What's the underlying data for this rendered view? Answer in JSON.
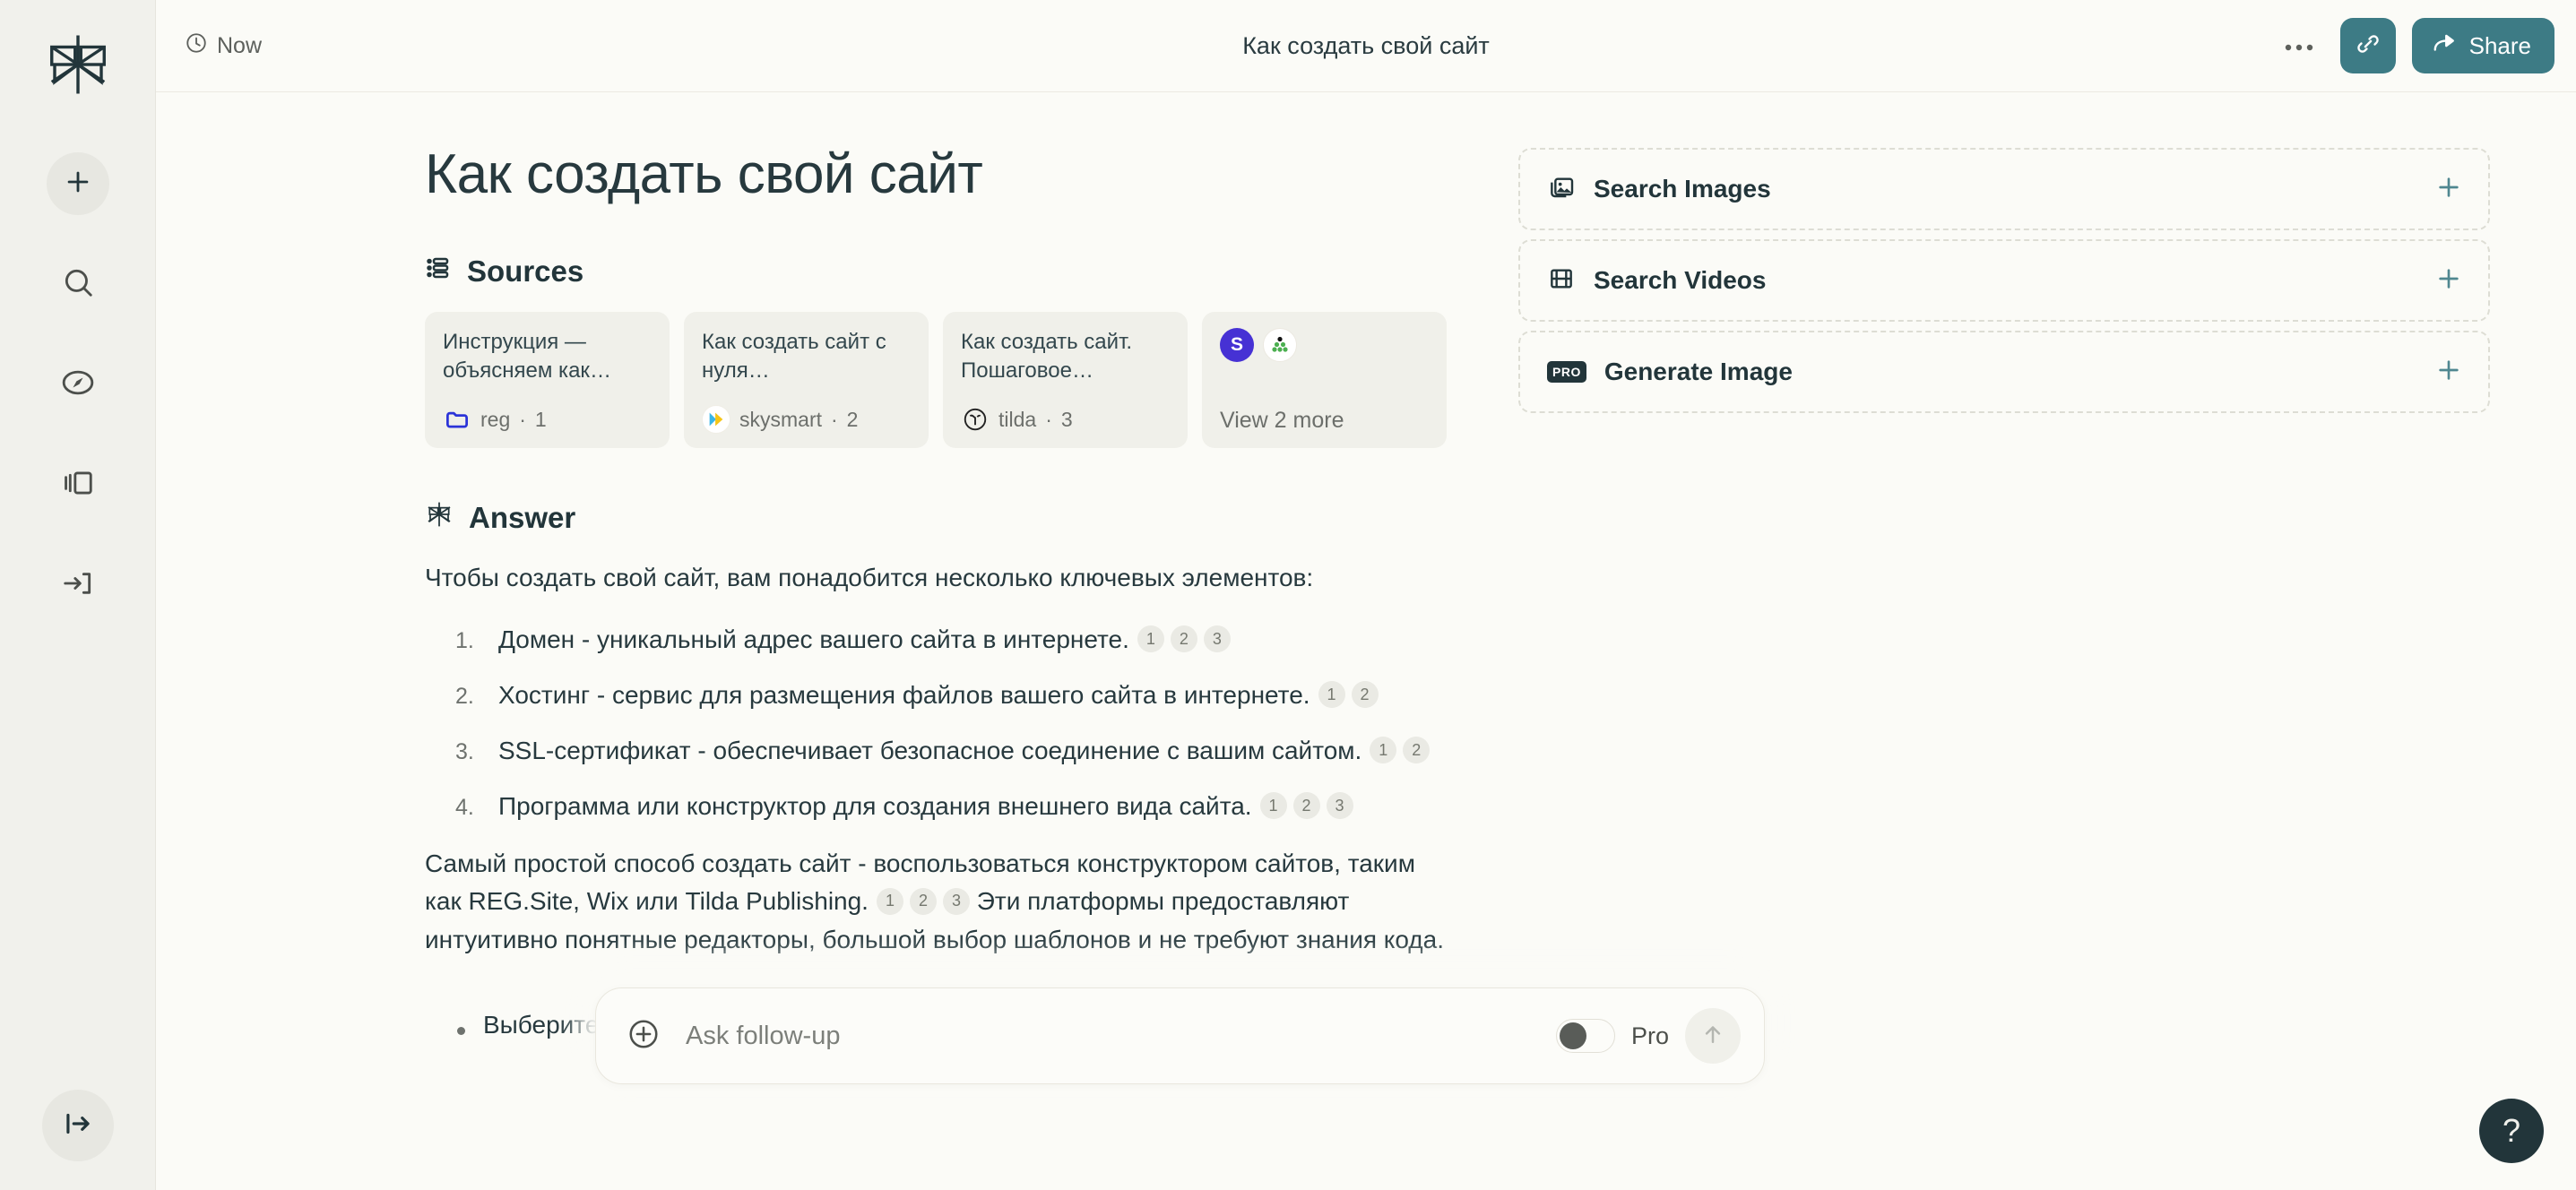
{
  "colors": {
    "accent_teal": "#3d7b85",
    "dark": "#22353a",
    "rail_bg": "#f1f1ec",
    "page_bg": "#fbfbf7",
    "card_bg": "#f0f0ea"
  },
  "sidebar": {
    "logo_name": "perplexity-logo",
    "items": [
      {
        "name": "new-thread",
        "icon": "plus-icon"
      },
      {
        "name": "search",
        "icon": "search-icon"
      },
      {
        "name": "discover",
        "icon": "compass-icon"
      },
      {
        "name": "library",
        "icon": "library-icon"
      },
      {
        "name": "sign-in",
        "icon": "sign-in-icon"
      }
    ],
    "expand": {
      "name": "expand-sidebar",
      "icon": "arrow-right-from-bar-icon"
    }
  },
  "topbar": {
    "timestamp": "Now",
    "timestamp_icon": "clock-icon",
    "title": "Как создать свой сайт",
    "more_label": "•••",
    "link_icon": "link-icon",
    "share_label": "Share",
    "share_icon": "share-arrow-icon"
  },
  "page": {
    "title": "Как создать свой сайт"
  },
  "sources": {
    "heading": "Sources",
    "heading_icon": "list-icon",
    "cards": [
      {
        "title": "Инструкция — объясняем как создать…",
        "site": "reg",
        "index": "1",
        "favicon": "reg-folder-icon",
        "favicon_color": "#2c34d8"
      },
      {
        "title": "Как создать сайт с нуля самостоятельно -…",
        "site": "skysmart",
        "index": "2",
        "favicon": "skysmart-play-icon",
        "favicon_color": "#f5c518"
      },
      {
        "title": "Как создать сайт. Пошаговое руководство…",
        "site": "tilda",
        "index": "3",
        "favicon": "tilda-icon",
        "favicon_color": "#222222"
      }
    ],
    "more": {
      "label": "View 2 more",
      "avatars": [
        {
          "name": "avatar-s",
          "text": "S",
          "color": "#4631d4"
        },
        {
          "name": "avatar-green-dots",
          "text": "",
          "color": "#ffffff"
        }
      ]
    }
  },
  "answer": {
    "heading": "Answer",
    "heading_icon": "perplexity-star-icon",
    "intro": "Чтобы создать свой сайт, вам понадобится несколько ключевых элементов:",
    "list": [
      {
        "num": "1.",
        "text": "Домен - уникальный адрес вашего сайта в интернете.",
        "cites": [
          "1",
          "2",
          "3"
        ]
      },
      {
        "num": "2.",
        "text": "Хостинг - сервис для размещения файлов вашего сайта в интернете.",
        "cites": [
          "1",
          "2"
        ]
      },
      {
        "num": "3.",
        "text": "SSL-сертификат - обеспечивает безопасное соединение с вашим сайтом.",
        "cites": [
          "1",
          "2"
        ]
      },
      {
        "num": "4.",
        "text": "Программа или конструктор для создания внешнего вида сайта.",
        "cites": [
          "1",
          "2",
          "3"
        ]
      }
    ],
    "para_before_cites": "Самый простой способ создать сайт - воспользоваться конструктором сайтов, таким как REG.Site, Wix или Tilda Publishing.",
    "para_cites": [
      "1",
      "2",
      "3"
    ],
    "para_after_cites": "Эти платформы предоставляют интуитивно понятные редакторы, большой выбор шаблонов и не требуют знания кода.",
    "bullets": [
      {
        "text": "Выберите подходящий шаблон"
      }
    ]
  },
  "right_panel": {
    "actions": [
      {
        "label": "Search Images",
        "icon": "images-icon",
        "plus": "plus-icon",
        "pro": false
      },
      {
        "label": "Search Videos",
        "icon": "video-icon",
        "plus": "plus-icon",
        "pro": false
      },
      {
        "label": "Generate Image",
        "icon": "pro-badge-icon",
        "plus": "plus-icon",
        "pro": true,
        "pro_text": "PRO"
      }
    ]
  },
  "ask_bar": {
    "attach_icon": "plus-circle-icon",
    "placeholder": "Ask follow-up",
    "value": "",
    "pro_label": "Pro",
    "pro_enabled": false,
    "send_icon": "arrow-up-icon"
  },
  "help": {
    "label": "?",
    "name": "help-button"
  }
}
